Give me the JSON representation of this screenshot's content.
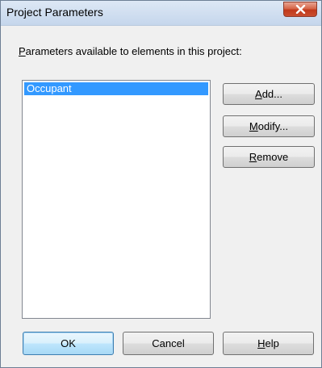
{
  "window": {
    "title": "Project Parameters"
  },
  "prompt": {
    "mnemonic": "P",
    "rest": "arameters available to elements in this project:"
  },
  "list": {
    "items": [
      "Occupant"
    ],
    "selected_index": 0
  },
  "side_buttons": {
    "add": {
      "mnemonic": "A",
      "rest": "dd..."
    },
    "modify": {
      "mnemonic": "M",
      "rest": "odify..."
    },
    "remove": {
      "mnemonic": "R",
      "rest": "emove"
    }
  },
  "footer_buttons": {
    "ok": "OK",
    "cancel": "Cancel",
    "help": {
      "mnemonic": "H",
      "rest": "elp"
    }
  },
  "colors": {
    "selection": "#3399ff",
    "close_button": "#c94e2f",
    "titlebar": "#c5d6ec",
    "dialog_bg": "#f0f0f0"
  }
}
